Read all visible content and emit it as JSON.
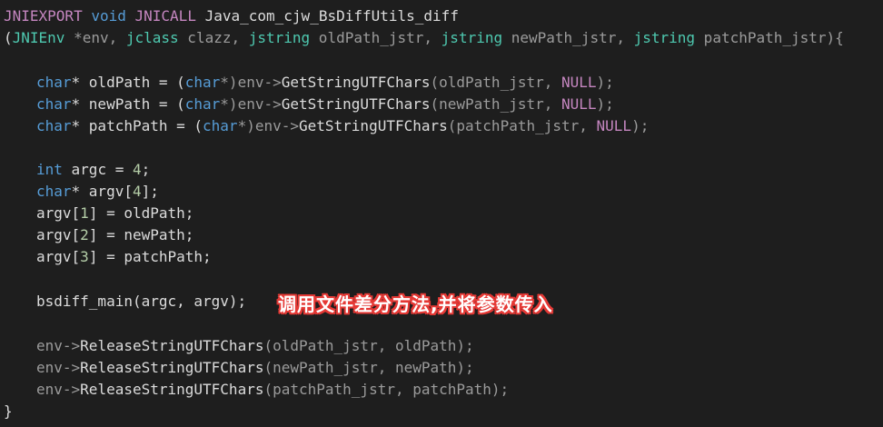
{
  "code": {
    "l1": {
      "macro1": "JNIEXPORT",
      "void": "void",
      "macro2": "JNICALL",
      "fname": "Java_com_cjw_BsDiffUtils_diff"
    },
    "l2": {
      "open": "(",
      "t1": "JNIEnv",
      "a1": " *env, ",
      "t2": "jclass",
      "a2": " clazz, ",
      "t3": "jstring",
      "a3": " oldPath_jstr, ",
      "t4": "jstring",
      "a4": " newPath_jstr, ",
      "t5": "jstring",
      "a5": " patchPath_jstr){"
    },
    "l3": {
      "type": "char",
      "decl": "* oldPath = (",
      "cast": "char",
      "mid": "*)env->",
      "fn": "GetStringUTFChars",
      "args": "(oldPath_jstr, ",
      "null": "NULL",
      "end": ");"
    },
    "l4": {
      "type": "char",
      "decl": "* newPath = (",
      "cast": "char",
      "mid": "*)env->",
      "fn": "GetStringUTFChars",
      "args": "(newPath_jstr, ",
      "null": "NULL",
      "end": ");"
    },
    "l5": {
      "type": "char",
      "decl": "* patchPath = (",
      "cast": "char",
      "mid": "*)env->",
      "fn": "GetStringUTFChars",
      "args": "(patchPath_jstr, ",
      "null": "NULL",
      "end": ");"
    },
    "l6": {
      "type": "int",
      "decl": " argc = ",
      "num": "4",
      "end": ";"
    },
    "l7": {
      "type": "char",
      "decl": "* argv[",
      "num": "4",
      "end": "];"
    },
    "l8": {
      "a": "argv[",
      "num": "1",
      "b": "] = oldPath;"
    },
    "l9": {
      "a": "argv[",
      "num": "2",
      "b": "] = newPath;"
    },
    "l10": {
      "a": "argv[",
      "num": "3",
      "b": "] = patchPath;"
    },
    "l11": {
      "text": "bsdiff_main(argc, argv);"
    },
    "l12": {
      "obj": "env->",
      "fn": "ReleaseStringUTFChars",
      "args": "(oldPath_jstr, oldPath);"
    },
    "l13": {
      "obj": "env->",
      "fn": "ReleaseStringUTFChars",
      "args": "(newPath_jstr, newPath);"
    },
    "l14": {
      "obj": "env->",
      "fn": "ReleaseStringUTFChars",
      "args": "(patchPath_jstr, patchPath);"
    },
    "l15": {
      "text": "}"
    }
  },
  "annotation": "调用文件差分方法,并将参数传入",
  "colors": {
    "background": "#1e1e1e",
    "macro": "#c586c0",
    "keyword": "#569cd6",
    "type": "#4ec9b0",
    "annotation_outline": "#e53935"
  }
}
